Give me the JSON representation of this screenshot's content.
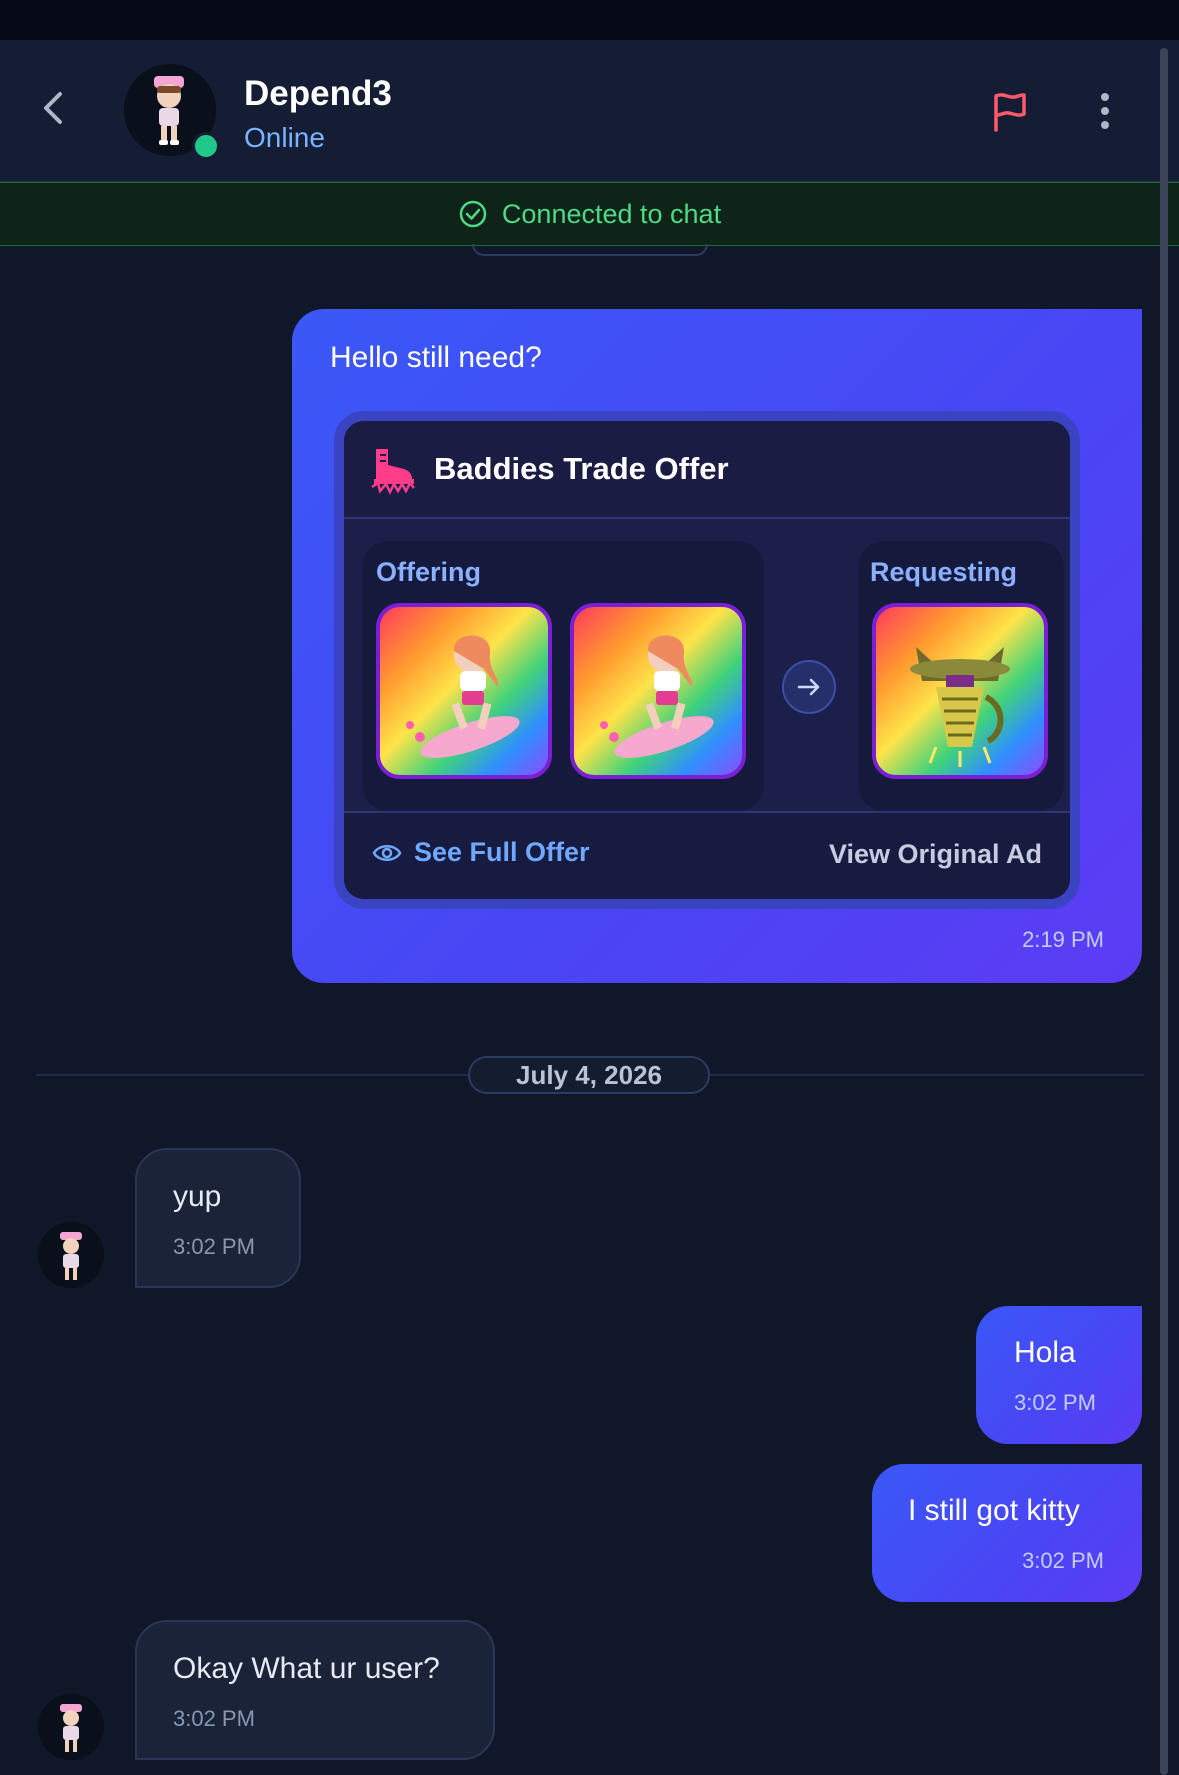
{
  "header": {
    "contact_name": "Depend3",
    "status": "Online"
  },
  "connection_banner": {
    "text": "Connected to chat"
  },
  "messages": {
    "first": {
      "text": "Hello still need?",
      "time": "2:19 PM",
      "trade_offer": {
        "title": "Baddies Trade Offer",
        "offering_label": "Offering",
        "requesting_label": "Requesting",
        "see_full_offer": "See Full Offer",
        "view_original_ad": "View Original Ad"
      }
    },
    "date_separator": "July 4, 2026",
    "m1": {
      "text": "yup",
      "time": "3:02 PM"
    },
    "m2": {
      "text": "Hola",
      "time": "3:02 PM"
    },
    "m3": {
      "text": "I still got kitty",
      "time": "3:02 PM"
    },
    "m4": {
      "text": "Okay What ur user?",
      "time": "3:02 PM"
    }
  },
  "colors": {
    "background": "#0f1729",
    "outgoing_bubble": "#4a45f5",
    "incoming_bubble": "#1a2338",
    "online": "#20c98a",
    "connected_text": "#4fd885",
    "flag": "#ff5a6a"
  },
  "icons": {
    "back": "chevron-left-icon",
    "report": "flag-icon",
    "menu": "more-vertical-icon",
    "connected": "check-circle-icon",
    "trade_arrow": "arrow-right-icon",
    "see_full": "eye-icon",
    "game_logo": "roller-skate-icon"
  }
}
